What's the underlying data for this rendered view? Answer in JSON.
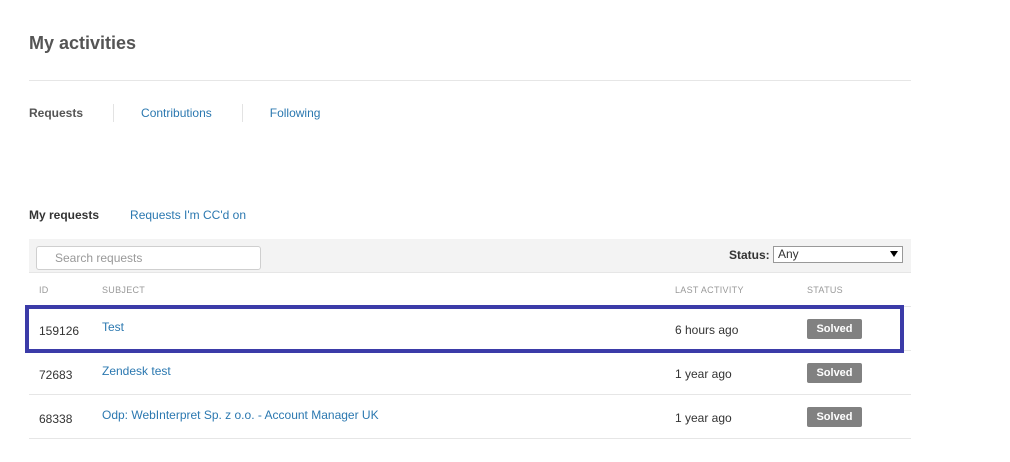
{
  "header": {
    "title": "My activities"
  },
  "nav": {
    "items": [
      {
        "label": "Requests",
        "active": true
      },
      {
        "label": "Contributions",
        "active": false
      },
      {
        "label": "Following",
        "active": false
      }
    ]
  },
  "subnav": {
    "items": [
      {
        "label": "My requests",
        "active": true
      },
      {
        "label": "Requests I'm CC'd on",
        "active": false
      }
    ]
  },
  "filter": {
    "search_placeholder": "Search requests",
    "status_label": "Status:",
    "status_value": "Any"
  },
  "table": {
    "columns": [
      "ID",
      "SUBJECT",
      "LAST ACTIVITY",
      "STATUS"
    ],
    "rows": [
      {
        "id": "159126",
        "subject": "Test",
        "last_activity": "6 hours ago",
        "status": "Solved"
      },
      {
        "id": "72683",
        "subject": "Zendesk test",
        "last_activity": "1 year ago",
        "status": "Solved"
      },
      {
        "id": "68338",
        "subject": "Odp: WebInterpret Sp. z o.o. - Account Manager UK",
        "last_activity": "1 year ago",
        "status": "Solved"
      }
    ]
  },
  "colors": {
    "link": "#2b78b0",
    "badge": "#818181",
    "highlight": "#3b3ba8"
  }
}
